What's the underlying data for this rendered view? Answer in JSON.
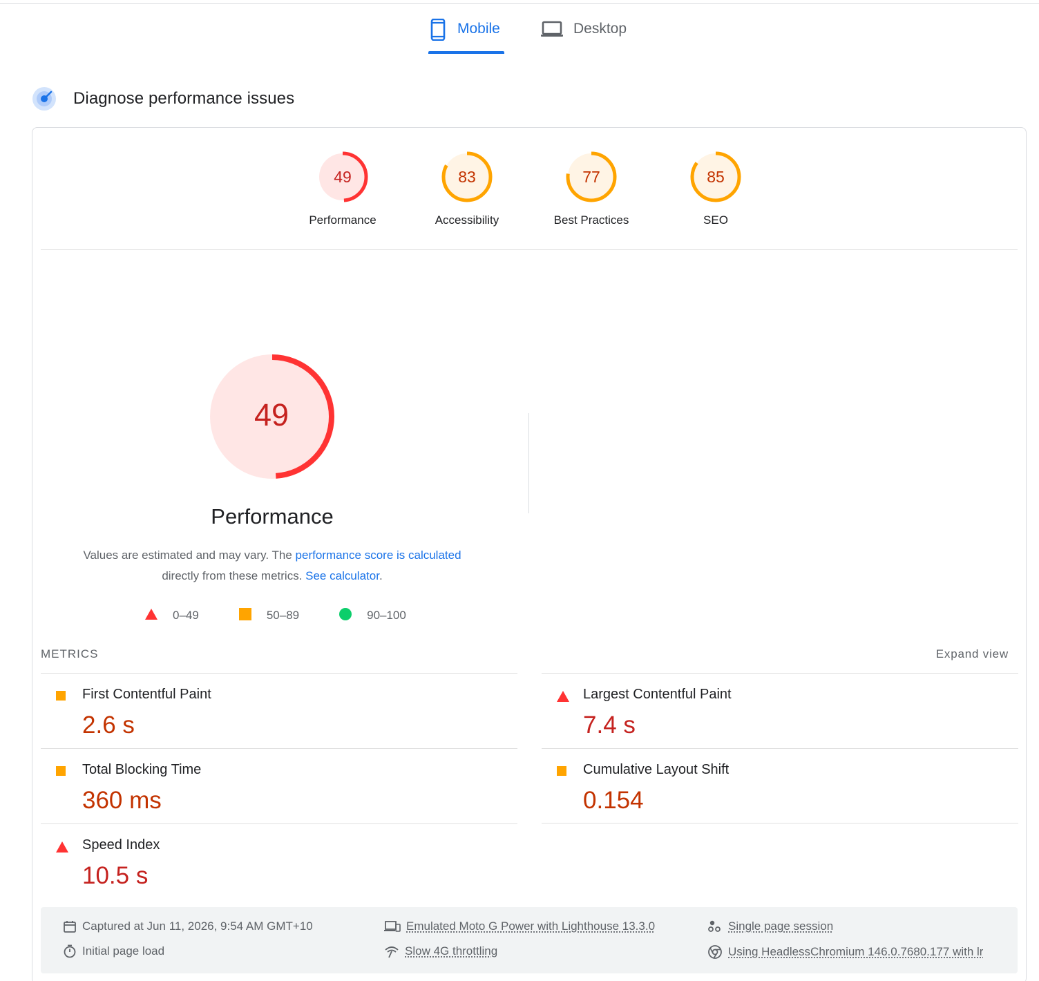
{
  "tabs": [
    {
      "label": "Mobile",
      "icon": "smartphone-icon",
      "active": true
    },
    {
      "label": "Desktop",
      "icon": "laptop-icon",
      "active": false
    }
  ],
  "section": {
    "title": "Diagnose performance issues",
    "icon": "lighthouse-radar-icon"
  },
  "categories": [
    {
      "label": "Performance",
      "score": 49,
      "rating": "fail"
    },
    {
      "label": "Accessibility",
      "score": 83,
      "rating": "average"
    },
    {
      "label": "Best Practices",
      "score": 77,
      "rating": "average"
    },
    {
      "label": "SEO",
      "score": 85,
      "rating": "average"
    }
  ],
  "performance": {
    "score": "49",
    "title": "Performance",
    "note_prefix": "Values are estimated and may vary. The ",
    "note_link1": "performance score is calculated",
    "note_middle": " directly from these metrics. ",
    "note_link2": "See calculator",
    "note_suffix": "."
  },
  "legend": [
    {
      "label": "0–49",
      "shape": "triangle",
      "color": "#ff3333"
    },
    {
      "label": "50–89",
      "shape": "square",
      "color": "#ffa400"
    },
    {
      "label": "90–100",
      "shape": "circle",
      "color": "#0cce6b"
    }
  ],
  "metrics": {
    "title": "METRICS",
    "expand_label": "Expand view",
    "items": [
      {
        "name": "First Contentful Paint",
        "value": "2.6 s",
        "rating": "average"
      },
      {
        "name": "Largest Contentful Paint",
        "value": "7.4 s",
        "rating": "fail"
      },
      {
        "name": "Total Blocking Time",
        "value": "360 ms",
        "rating": "average"
      },
      {
        "name": "Cumulative Layout Shift",
        "value": "0.154",
        "rating": "average"
      },
      {
        "name": "Speed Index",
        "value": "10.5 s",
        "rating": "fail"
      }
    ]
  },
  "run_info": {
    "captured": "Captured at Jun 11, 2026, 9:54 AM GMT+10",
    "load_type": "Initial page load",
    "device": "Emulated Moto G Power with Lighthouse 13.3.0",
    "throttling": "Slow 4G throttling",
    "session": "Single page session",
    "browser": "Using HeadlessChromium 146.0.7680.177 with lr"
  },
  "colors": {
    "accent": "#1a73e8",
    "fail": "#ff3333",
    "average": "#ffa400",
    "pass": "#0cce6b",
    "fail_text": "#c5221f",
    "average_text": "#c33300"
  }
}
